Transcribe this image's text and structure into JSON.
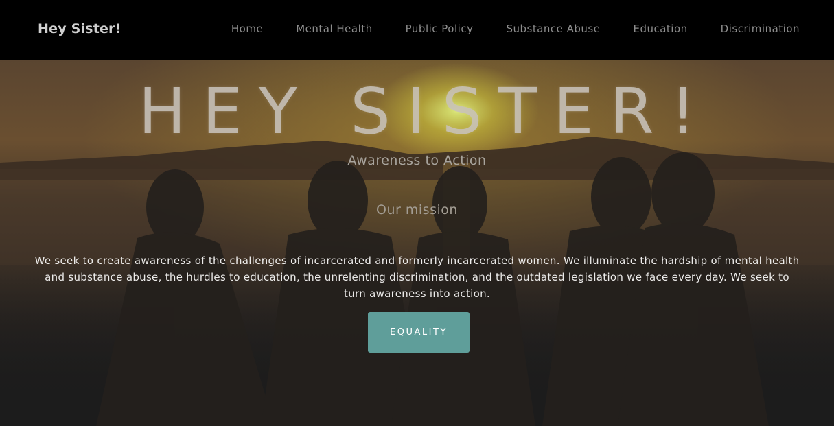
{
  "nav": {
    "brand": "Hey Sister!",
    "links": [
      "Home",
      "Mental Health",
      "Public Policy",
      "Substance Abuse",
      "Education",
      "Discrimination"
    ]
  },
  "hero": {
    "title": "HEY SISTER!",
    "subtitle": "Awareness to Action",
    "mission_heading": "Our mission",
    "mission_text": "We seek to create awareness of the challenges of incarcerated and formerly incarcerated women. We illuminate the hardship of mental health and substance abuse, the hurdles to education, the unrelenting discrimination, and the outdated legislation we face every day. We seek to turn awareness into action.",
    "cta_label": "EQUALITY",
    "background_image": "sunset-silhouettes-photo"
  },
  "colors": {
    "navbar_bg": "#000000",
    "cta_bg": "#5f9e9a",
    "page_bg": "#1c1c1c"
  }
}
